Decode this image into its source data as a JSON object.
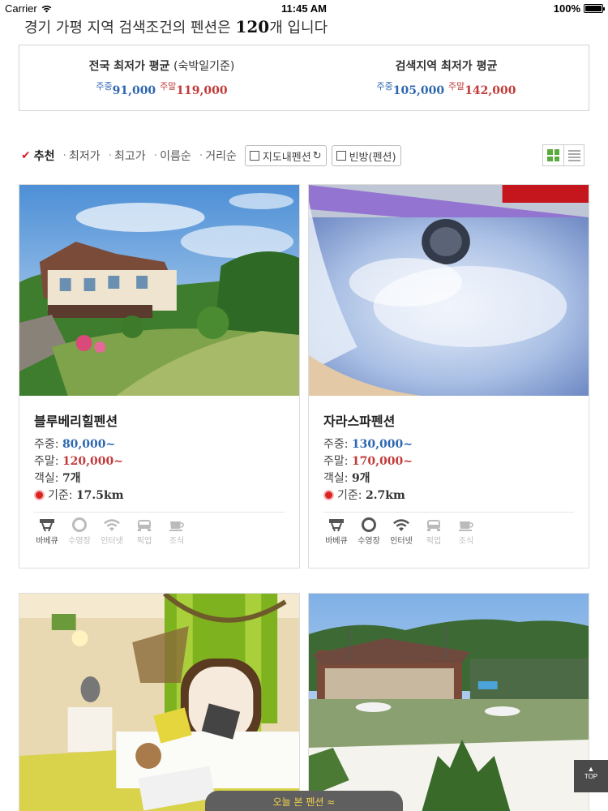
{
  "status_bar": {
    "carrier": "Carrier",
    "time": "11:45 AM",
    "battery": "100%"
  },
  "headline": {
    "prefix": "경기 가평 지역 검색조건의 펜션은 ",
    "count": "120",
    "suffix": "개 입니다"
  },
  "summary": {
    "national": {
      "title": "전국 최저가 평균",
      "note": " (숙박일기준)",
      "weekday_tag": "주중",
      "weekday_price": "91,000",
      "weekend_tag": "주말",
      "weekend_price": "119,000"
    },
    "region": {
      "title": "검색지역 최저가 평균",
      "weekday_tag": "주중",
      "weekday_price": "105,000",
      "weekend_tag": "주말",
      "weekend_price": "142,000"
    }
  },
  "sort": {
    "items": [
      "추천",
      "최저가",
      "최고가",
      "이름순",
      "거리순"
    ],
    "filters": [
      "지도내펜션",
      "빈방(펜션)"
    ]
  },
  "listings": [
    {
      "name": "블루베리힐펜션",
      "weekday_label": "주중: ",
      "weekday": "80,000~",
      "weekend_label": "주말: ",
      "weekend": "120,000~",
      "rooms_label": "객실: ",
      "rooms": "7개",
      "distance_label": "기준: ",
      "distance": "17.5km",
      "amenities": [
        {
          "label": "바베큐",
          "icon": "bbq-icon",
          "available": true
        },
        {
          "label": "수영장",
          "icon": "pool-icon",
          "available": false
        },
        {
          "label": "인터넷",
          "icon": "wifi-icon",
          "available": false
        },
        {
          "label": "픽업",
          "icon": "car-icon",
          "available": false
        },
        {
          "label": "조식",
          "icon": "breakfast-icon",
          "available": false
        }
      ]
    },
    {
      "name": "자라스파펜션",
      "weekday_label": "주중: ",
      "weekday": "130,000~",
      "weekend_label": "주말: ",
      "weekend": "170,000~",
      "rooms_label": "객실: ",
      "rooms": "9개",
      "distance_label": "기준: ",
      "distance": "2.7km",
      "amenities": [
        {
          "label": "바베큐",
          "icon": "bbq-icon",
          "available": true
        },
        {
          "label": "수영장",
          "icon": "pool-icon",
          "available": true
        },
        {
          "label": "인터넷",
          "icon": "wifi-icon",
          "available": true
        },
        {
          "label": "픽업",
          "icon": "car-icon",
          "available": false
        },
        {
          "label": "조식",
          "icon": "breakfast-icon",
          "available": false
        }
      ]
    }
  ],
  "recent_bar": "오늘 본 펜션 ≈",
  "top_button": "TOP",
  "colors": {
    "weekday": "#2e67b1",
    "weekend": "#c23b3b",
    "accent_green": "#5aab3c"
  }
}
